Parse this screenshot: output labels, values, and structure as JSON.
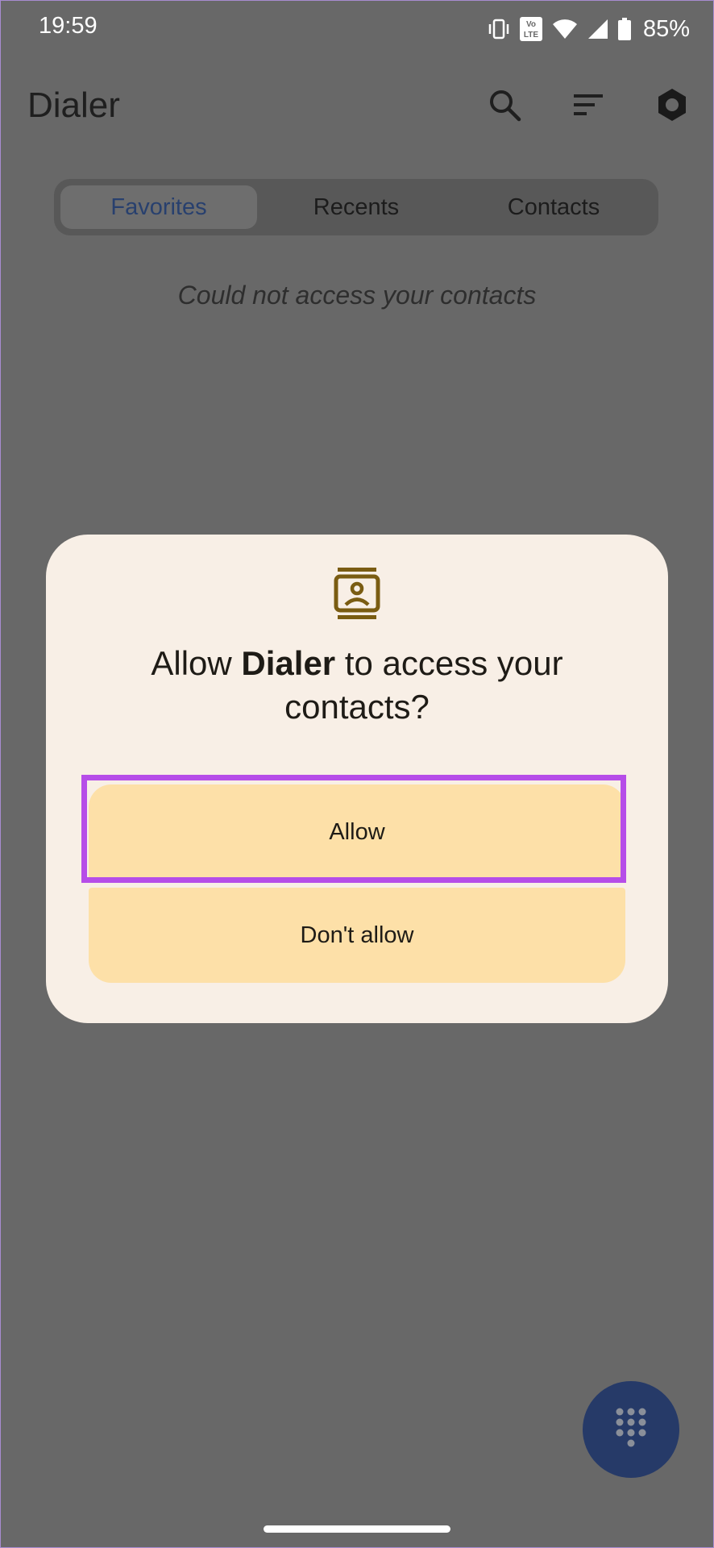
{
  "status_bar": {
    "time": "19:59",
    "battery_percent": "85%",
    "icons": [
      "vibrate-icon",
      "volte-icon",
      "wifi-icon",
      "cellular-signal-icon",
      "battery-icon"
    ]
  },
  "app_bar": {
    "title": "Dialer",
    "actions": [
      "search-icon",
      "sort-icon",
      "settings-icon"
    ]
  },
  "tabs": [
    {
      "label": "Favorites",
      "selected": true
    },
    {
      "label": "Recents",
      "selected": false
    },
    {
      "label": "Contacts",
      "selected": false
    }
  ],
  "main": {
    "empty_message": "Could not access your contacts"
  },
  "permission_dialog": {
    "icon": "contacts-icon",
    "title_prefix": "Allow ",
    "title_app": "Dialer",
    "title_suffix": " to access your contacts?",
    "allow_label": "Allow",
    "deny_label": "Don't allow"
  },
  "fab": {
    "icon": "dialpad-icon"
  },
  "colors": {
    "scrim": "#686868",
    "dialog_background": "#f8efe6",
    "button_background": "#fde0a8",
    "highlight_outline": "#b64de8",
    "fab_background": "#263a68",
    "selected_tab_text": "#28406e"
  }
}
